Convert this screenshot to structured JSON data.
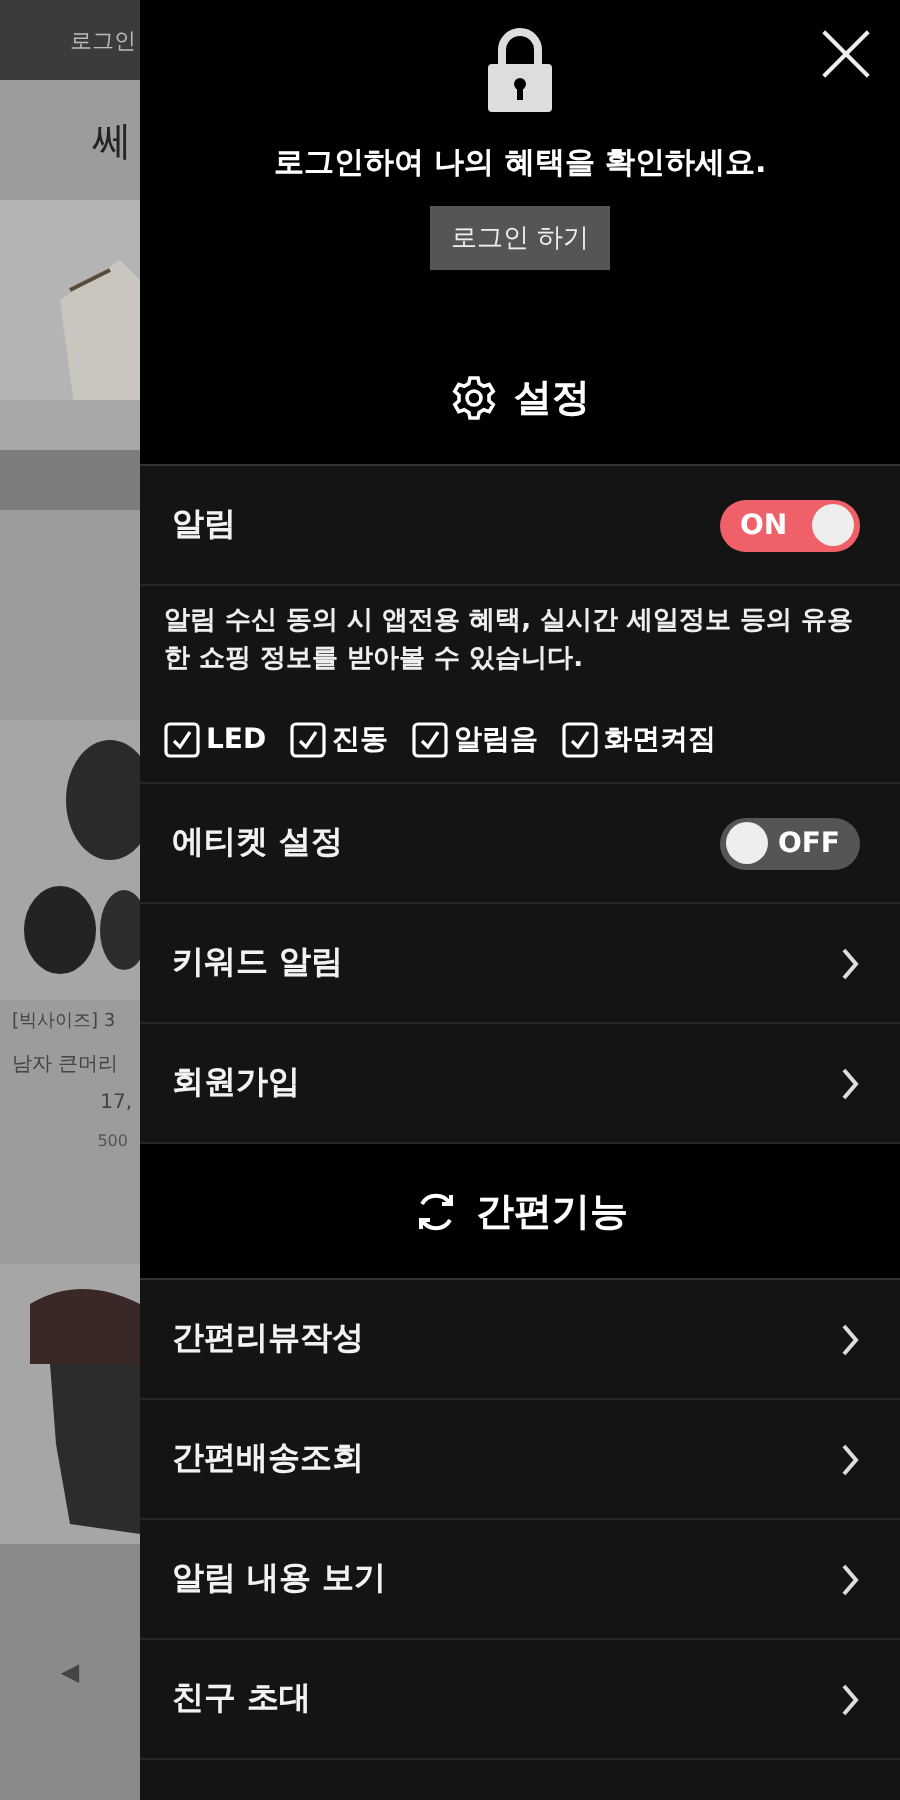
{
  "background_page": {
    "top_bar_text": "로그인",
    "title": "쎄",
    "product": {
      "name": "[빅사이즈] 3",
      "subtitle": "남자 큰머리",
      "price": "17,",
      "reviews": "500"
    },
    "back_button": "◀"
  },
  "drawer": {
    "login_prompt": "로그인하여 나의 혜택을 확인하세요.",
    "login_button": "로그인 하기",
    "settings_header": "설정",
    "toggles": [
      {
        "label": "알림",
        "on": true,
        "toggle_text": "ON"
      },
      {
        "label": "에티켓 설정",
        "on": false,
        "toggle_text": "OFF"
      }
    ],
    "notification_description": "알림 수신 동의 시 앱전용 혜택, 실시간 세일정보 등의 유용한 쇼핑 정보를 받아볼 수 있습니다.",
    "notification_options": [
      {
        "label": "LED",
        "checked": true
      },
      {
        "label": "진동",
        "checked": true
      },
      {
        "label": "알림음",
        "checked": true
      },
      {
        "label": "화면켜짐",
        "checked": true
      }
    ],
    "settings_links": [
      {
        "label": "키워드 알림"
      },
      {
        "label": "회원가입"
      }
    ],
    "quick_header": "간편기능",
    "quick_links": [
      {
        "label": "간편리뷰작성"
      },
      {
        "label": "간편배송조회"
      },
      {
        "label": "알림 내용 보기"
      },
      {
        "label": "친구 초대"
      }
    ]
  }
}
